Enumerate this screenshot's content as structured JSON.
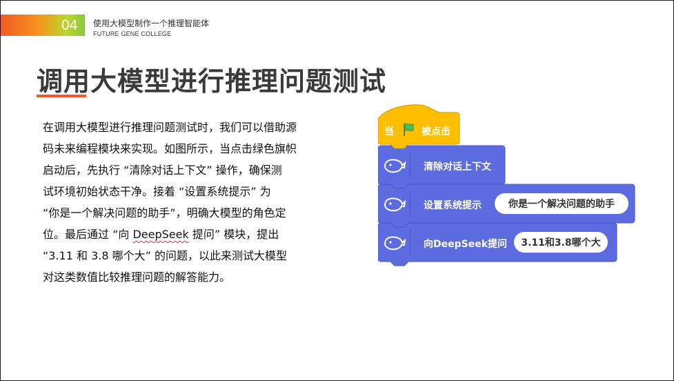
{
  "header": {
    "section_number": "04",
    "section_title": "使用大模型制作一个推理智能体",
    "college": "FUTURE GENE COLLEGE"
  },
  "title": "调用大模型进行推理问题测试",
  "body": {
    "lines": [
      "在调用大模型进行推理问题测试时，我们可以借助源",
      "码未来编程模块来实现。如图所示，当点击绿色旗帜",
      "启动后，先执行 “清除对话上下文” 操作，确保测",
      "试环境初始状态干净。接着 “设置系统提示” 为",
      "“你是一个解决问题的助手”，明确大模型的角色定"
    ],
    "line6_pre": "位。最后通过 “向 ",
    "line6_word": "DeepSeek",
    "line6_post": " 提问” 模块，提出",
    "line7": "“3.11 和 3.8 哪个大” 的问题，以此来测试大模型",
    "line8": "对这类数值比较推理问题的解答能力。"
  },
  "blocks": {
    "hat_when": "当",
    "hat_clicked": "被点击",
    "clear_label": "清除对话上下文",
    "system_label": "设置系统提示",
    "system_value": "你是一个解决问题的助手",
    "ask_label": "向DeepSeek提问",
    "ask_value": "3.11和3.8哪个大"
  },
  "colors": {
    "hat": "#ffbf00",
    "block": "#5c6bdf",
    "block_border": "#4a56c4",
    "flag": "#4cbf56",
    "accent": "#f05a24"
  },
  "icons": [
    "green-flag-icon",
    "whale-icon"
  ]
}
